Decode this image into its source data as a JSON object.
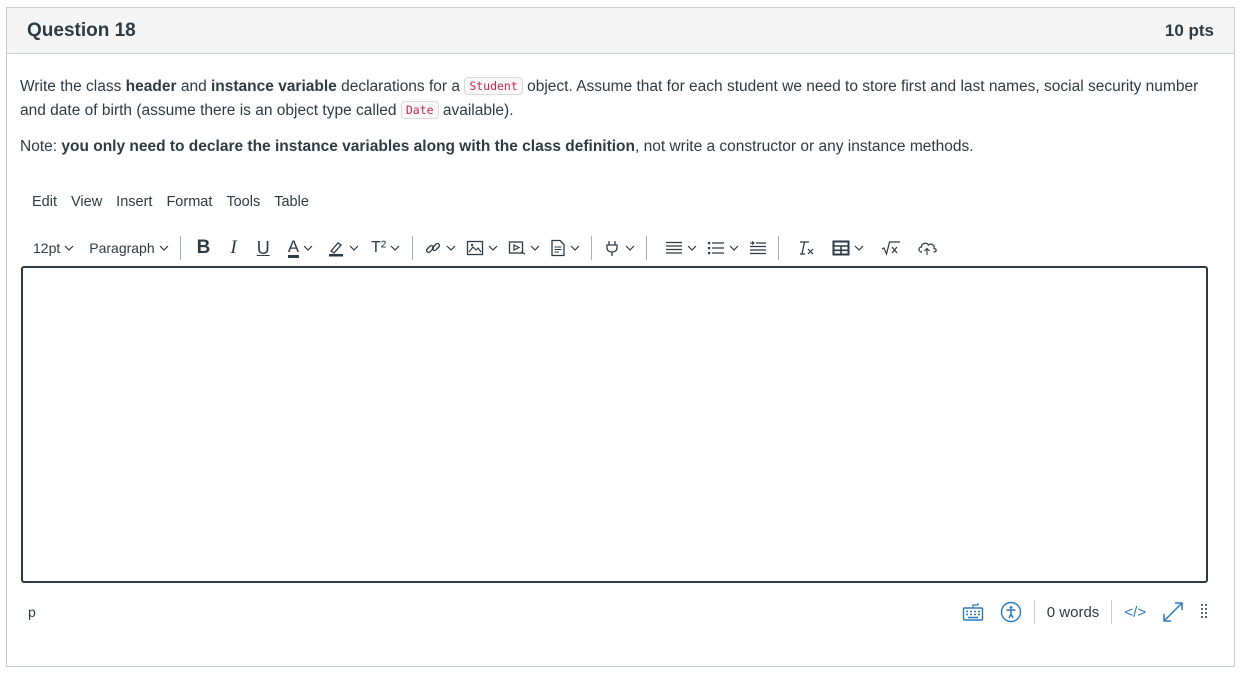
{
  "question": {
    "title": "Question 18",
    "points": "10 pts",
    "text": {
      "p1_a": "Write the class ",
      "p1_b": "header",
      "p1_c": " and ",
      "p1_d": "instance variable",
      "p1_e": " declarations for a ",
      "code_student": "Student",
      "p1_f": " object. Assume that for each student we need to store first and last names, social security number and date of birth (assume there is an object type called ",
      "code_date": "Date",
      "p1_g": " available).",
      "p2_a": "Note: ",
      "p2_b": "you only need to declare the instance variables along with the class definition",
      "p2_c": ", not write a constructor or any instance methods."
    }
  },
  "editor": {
    "menu": [
      "Edit",
      "View",
      "Insert",
      "Format",
      "Tools",
      "Table"
    ],
    "toolbar": {
      "font_size": "12pt",
      "block_format": "Paragraph",
      "bold": "B",
      "italic": "I",
      "underline": "U",
      "text_color": "A",
      "superscript": "T²"
    },
    "icons": [
      "chevron-down-icon",
      "link-icon",
      "image-icon",
      "media-icon",
      "document-icon",
      "plug-icon",
      "align-icon",
      "list-icon",
      "indent-icon",
      "clear-format-icon",
      "table-icon",
      "math-icon",
      "cloud-icon",
      "keyboard-icon",
      "accessibility-icon",
      "html-icon",
      "fullscreen-icon",
      "drag-handle-icon"
    ],
    "content": "",
    "status": {
      "path": "p",
      "word_count": "0 words",
      "html_toggle": "</>"
    }
  },
  "colors": {
    "text": "#2d3b45",
    "border": "#c7cdd1",
    "header_bg": "#f5f5f5",
    "code_text": "#c7254e",
    "accent": "#2b7abc"
  }
}
